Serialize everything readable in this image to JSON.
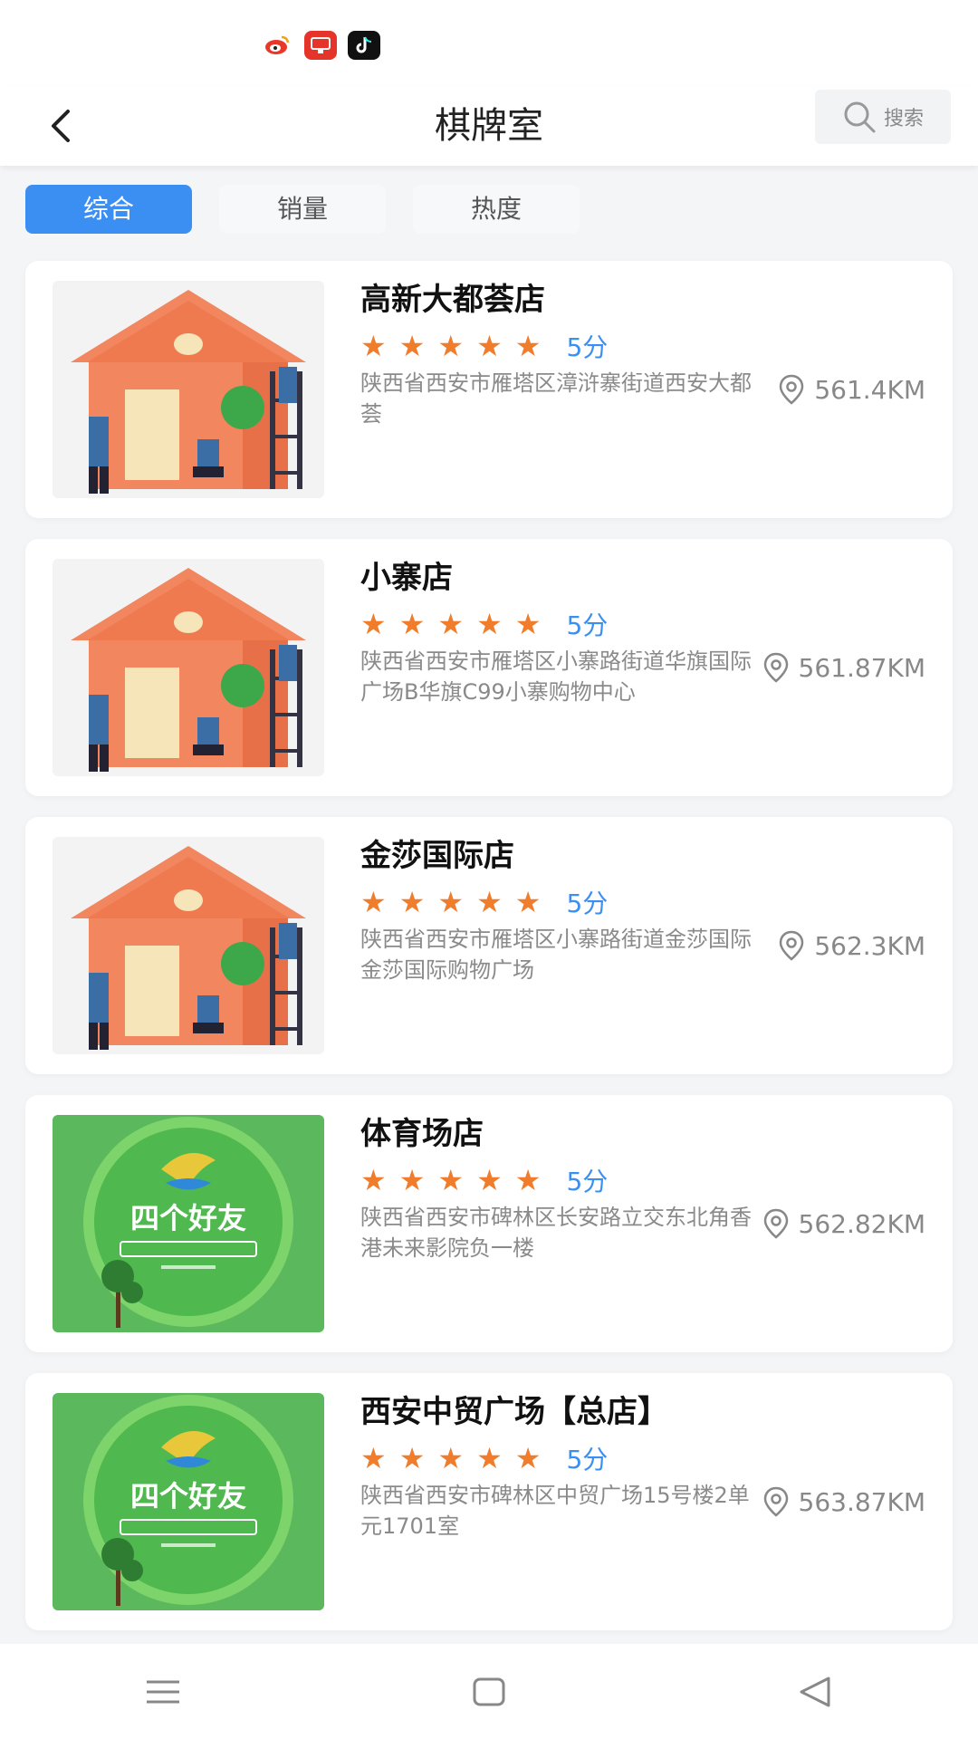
{
  "header": {
    "title": "棋牌室",
    "search_placeholder": "搜索"
  },
  "tabs": [
    "综合",
    "销量",
    "热度"
  ],
  "stores": [
    {
      "name": "高新大都荟店",
      "rating": "5分",
      "stars": 5,
      "address": "陕西省西安市雁塔区漳浒寨街道西安大都荟",
      "distance": "561.4KM",
      "image": "house-painting"
    },
    {
      "name": "小寨店",
      "rating": "5分",
      "stars": 5,
      "address": "陕西省西安市雁塔区小寨路街道华旗国际广场B华旗C99小寨购物中心",
      "distance": "561.87KM",
      "image": "house-painting"
    },
    {
      "name": "金莎国际店",
      "rating": "5分",
      "stars": 5,
      "address": "陕西省西安市雁塔区小寨路街道金莎国际金莎国际购物广场",
      "distance": "562.3KM",
      "image": "house-painting"
    },
    {
      "name": "体育场店",
      "rating": "5分",
      "stars": 5,
      "address": "陕西省西安市碑林区长安路立交东北角香港未来影院负一楼",
      "distance": "562.82KM",
      "image": "green-logo"
    },
    {
      "name": "西安中贸广场【总店】",
      "rating": "5分",
      "stars": 5,
      "address": "陕西省西安市碑林区中贸广场15号楼2单元1701室",
      "distance": "563.87KM",
      "image": "green-logo"
    }
  ],
  "logo_text": "四个好友",
  "colors": {
    "accent": "#3b8ff3",
    "star": "#f07d2c",
    "house": "#f2865f",
    "green": "#4caf50"
  }
}
